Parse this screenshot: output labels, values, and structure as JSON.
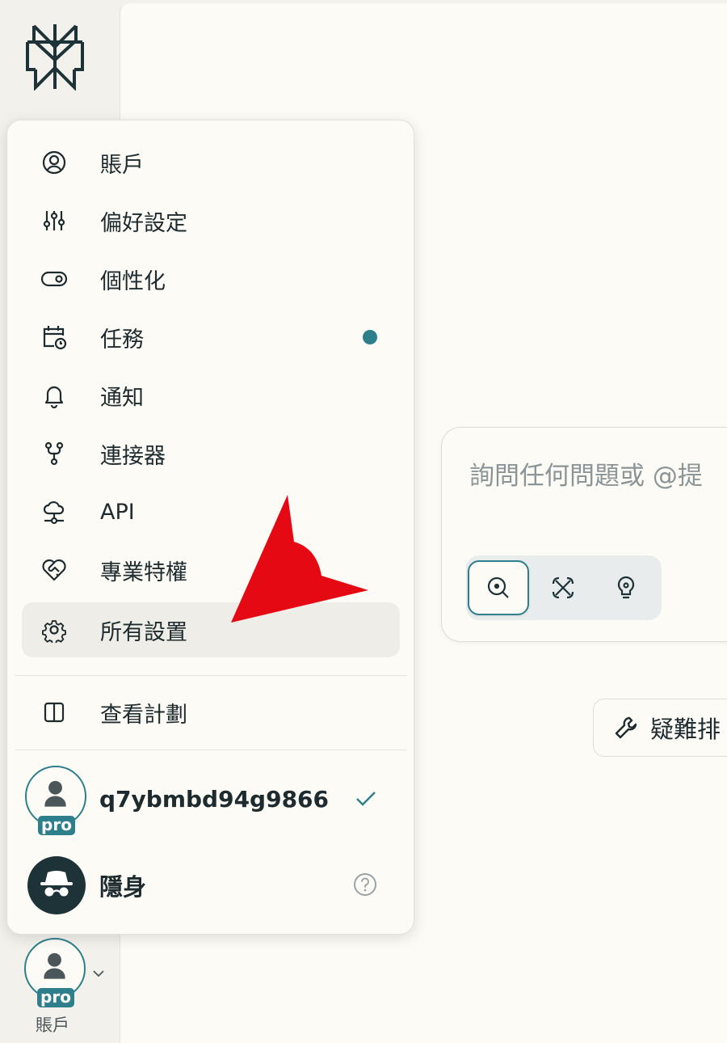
{
  "menu": {
    "items": [
      {
        "label": "賬戶",
        "icon": "user-circle-icon"
      },
      {
        "label": "偏好設定",
        "icon": "sliders-icon"
      },
      {
        "label": "個性化",
        "icon": "toggle-icon"
      },
      {
        "label": "任務",
        "icon": "calendar-clock-icon",
        "badge": "dot"
      },
      {
        "label": "通知",
        "icon": "bell-icon"
      },
      {
        "label": "連接器",
        "icon": "connector-icon"
      },
      {
        "label": "API",
        "icon": "cloud-network-icon"
      },
      {
        "label": "專業特權",
        "icon": "heart-handshake-icon"
      },
      {
        "label": "所有設置",
        "icon": "gear-icon",
        "hovered": true
      }
    ],
    "plan_label": "查看計劃",
    "accounts": [
      {
        "name": "q7ybmbd94g9866",
        "badge": "pro",
        "selected": true
      },
      {
        "name": "隱身",
        "type": "incognito"
      }
    ]
  },
  "main": {
    "ask_placeholder": "詢問任何問題或 @提",
    "troubleshoot_label": "疑難排"
  },
  "sidebar": {
    "account_label": "賬戶",
    "pro_badge": "pro"
  },
  "colors": {
    "accent": "#2d7f8c",
    "panel_bg": "#fcfbf6",
    "sidebar_bg": "#f2f1ec",
    "annotation_arrow": "#e50914"
  }
}
